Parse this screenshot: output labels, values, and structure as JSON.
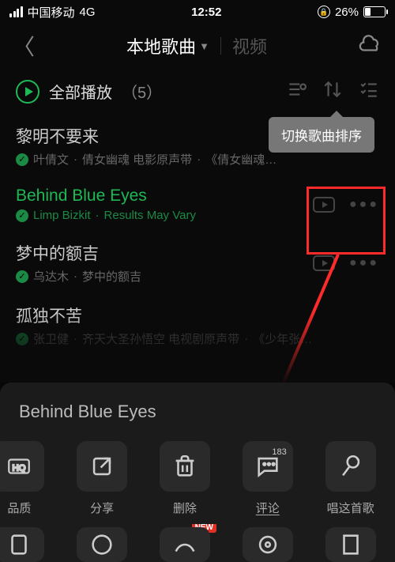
{
  "status": {
    "carrier": "中国移动",
    "network": "4G",
    "time": "12:52",
    "battery_pct": "26%"
  },
  "header": {
    "tab_local": "本地歌曲",
    "tab_video": "视频"
  },
  "playall": {
    "label": "全部播放",
    "count": "（5）"
  },
  "tooltip": "切换歌曲排序",
  "songs": [
    {
      "title": "黎明不要来",
      "artist": "叶倩文",
      "album": "倩女幽魂 电影原声带",
      "extra": "《倩女幽魂…",
      "active": false,
      "has_mv": false
    },
    {
      "title": "Behind Blue Eyes",
      "artist": "Limp Bizkit",
      "album": "Results May Vary",
      "extra": "",
      "active": true,
      "has_mv": true
    },
    {
      "title": "梦中的额吉",
      "artist": "乌达木",
      "album": "梦中的额吉",
      "extra": "",
      "active": false,
      "has_mv": true
    },
    {
      "title": "孤独不苦",
      "artist": "张卫健",
      "album": "齐天大圣孙悟空 电视剧原声带",
      "extra": "《少年张…",
      "active": false,
      "has_mv": false
    }
  ],
  "sheet": {
    "title": "Behind Blue Eyes",
    "actions_row1": {
      "quality": "品质",
      "share": "分享",
      "delete": "删除",
      "comment": "评论",
      "comment_count": "183",
      "sing": "唱这首歌"
    },
    "new_tag": "NEW"
  }
}
